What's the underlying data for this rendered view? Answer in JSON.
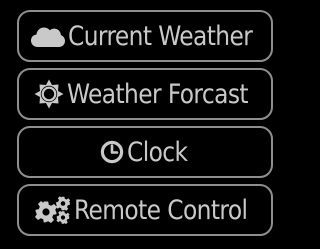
{
  "menu": {
    "items": [
      {
        "label": "Current Weather",
        "icon": "cloud-icon"
      },
      {
        "label": "Weather Forcast",
        "icon": "sun-icon"
      },
      {
        "label": "Clock",
        "icon": "clock-icon"
      },
      {
        "label": "Remote Control",
        "icon": "gears-icon"
      }
    ]
  },
  "colors": {
    "background": "#000000",
    "border": "#8e8e8e",
    "text": "#c9c9c9"
  }
}
